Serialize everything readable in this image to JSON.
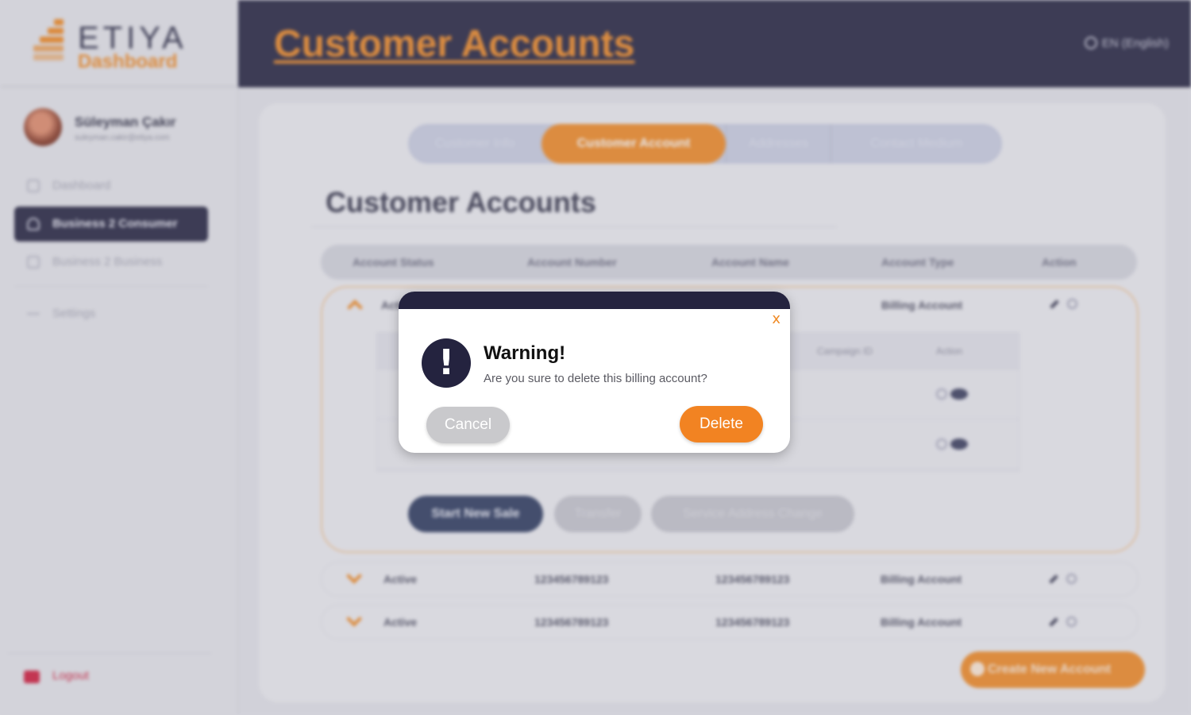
{
  "brand": {
    "name": "ETIYA",
    "sub": "Dashboard"
  },
  "header": {
    "title": "Customer Accounts",
    "language": "EN (English)"
  },
  "user": {
    "name": "Süleyman Çakır",
    "email": "suleyman.cakir@etiya.com"
  },
  "sidebar": {
    "items": [
      {
        "label": "Dashboard",
        "icon": "dashboard-icon",
        "active": false
      },
      {
        "label": "Business 2 Consumer",
        "icon": "user-icon",
        "active": true
      },
      {
        "label": "Business 2 Business",
        "icon": "calendar-icon",
        "active": false
      },
      {
        "label": "Settings",
        "icon": "settings-icon",
        "active": false
      }
    ],
    "logout": "Logout"
  },
  "tabs": [
    {
      "label": "Customer Info",
      "active": false
    },
    {
      "label": "Customer Account",
      "active": true
    },
    {
      "label": "Addresses",
      "active": false
    },
    {
      "label": "Contact Medium",
      "active": false
    }
  ],
  "section_title": "Customer Accounts",
  "table": {
    "columns": [
      "Account Status",
      "Account Number",
      "Account Name",
      "Account Type",
      "Action"
    ],
    "expanded_row": {
      "status": "Active",
      "type": "Billing Account"
    },
    "inner_columns": [
      "Campaign ID",
      "Action"
    ],
    "rows": [
      {
        "status": "Active",
        "number": "123456789123",
        "name": "123456789123",
        "type": "Billing Account"
      },
      {
        "status": "Active",
        "number": "123456789123",
        "name": "123456789123",
        "type": "Billing Account"
      }
    ],
    "actions": {
      "start_sale": "Start New Sale",
      "transfer": "Transfer",
      "service_change": "Service Address Change"
    }
  },
  "create_button": "Create New Account",
  "modal": {
    "close": "x",
    "title": "Warning!",
    "message": "Are you sure to delete this billing account?",
    "cancel": "Cancel",
    "delete": "Delete"
  },
  "colors": {
    "accent": "#f08a24",
    "navy": "#24233f"
  }
}
